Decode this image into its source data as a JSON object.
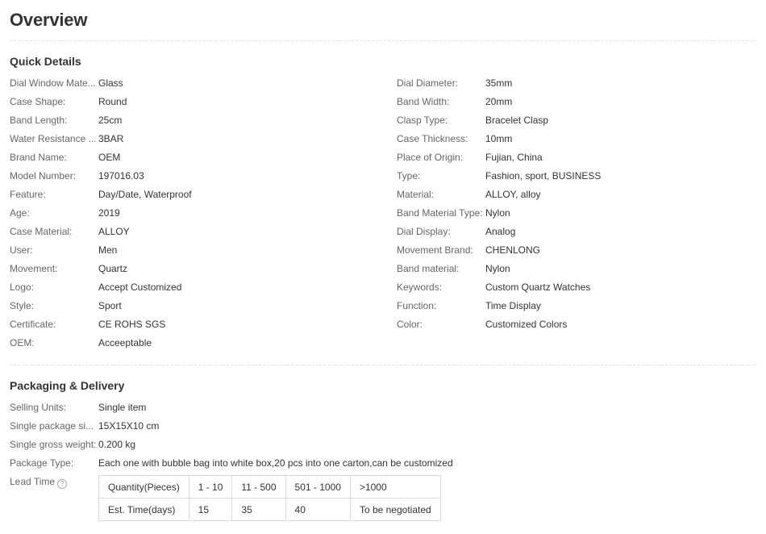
{
  "title": "Overview",
  "quick_details": {
    "heading": "Quick Details",
    "left": [
      {
        "label": "Dial Window Mate...",
        "value": "Glass"
      },
      {
        "label": "Case Shape:",
        "value": "Round"
      },
      {
        "label": "Band Length:",
        "value": "25cm"
      },
      {
        "label": "Water Resistance ...",
        "value": "3BAR"
      },
      {
        "label": "Brand Name:",
        "value": "OEM"
      },
      {
        "label": "Model Number:",
        "value": "197016.03"
      },
      {
        "label": "Feature:",
        "value": "Day/Date, Waterproof"
      },
      {
        "label": "Age:",
        "value": "2019"
      },
      {
        "label": "Case Material:",
        "value": "ALLOY"
      },
      {
        "label": "User:",
        "value": "Men"
      },
      {
        "label": "Movement:",
        "value": "Quartz"
      },
      {
        "label": "Logo:",
        "value": "Accept Customized"
      },
      {
        "label": "Style:",
        "value": "Sport"
      },
      {
        "label": "Certificate:",
        "value": "CE ROHS SGS"
      },
      {
        "label": "OEM:",
        "value": "Acceeptable"
      }
    ],
    "right": [
      {
        "label": "Dial Diameter:",
        "value": "35mm"
      },
      {
        "label": "Band Width:",
        "value": "20mm"
      },
      {
        "label": "Clasp Type:",
        "value": "Bracelet Clasp"
      },
      {
        "label": "Case Thickness:",
        "value": "10mm"
      },
      {
        "label": "Place of Origin:",
        "value": "Fujian, China"
      },
      {
        "label": "Type:",
        "value": "Fashion, sport, BUSINESS"
      },
      {
        "label": "Material:",
        "value": "ALLOY, alloy"
      },
      {
        "label": "Band Material Type:",
        "value": "Nylon"
      },
      {
        "label": "Dial Display:",
        "value": "Analog"
      },
      {
        "label": "Movement Brand:",
        "value": "CHENLONG"
      },
      {
        "label": "Band material:",
        "value": "Nylon"
      },
      {
        "label": "Keywords:",
        "value": "Custom Quartz Watches"
      },
      {
        "label": "Function:",
        "value": "Time Display"
      },
      {
        "label": "Color:",
        "value": "Customized Colors"
      }
    ]
  },
  "packaging": {
    "heading": "Packaging & Delivery",
    "rows": [
      {
        "label": "Selling Units:",
        "value": "Single item"
      },
      {
        "label": "Single package si...",
        "value": "15X15X10 cm"
      },
      {
        "label": "Single gross weight:",
        "value": "0.200 kg"
      },
      {
        "label": "Package Type:",
        "value": "Each one with bubble bag into white box,20 pcs into one carton,can be customized"
      }
    ],
    "lead_time": {
      "label": "Lead Time",
      "help_icon": "?",
      "quantity_header": "Quantity(Pieces)",
      "time_header": "Est. Time(days)",
      "quantities": [
        "1 - 10",
        "11 - 500",
        "501 - 1000",
        ">1000"
      ],
      "times": [
        "15",
        "35",
        "40",
        "To be negotiated"
      ]
    }
  }
}
